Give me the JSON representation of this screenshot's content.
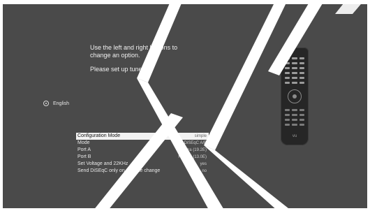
{
  "wizard": {
    "instruction_line1": "Use the left and right buttons to",
    "instruction_line2": "change an option.",
    "instruction_line3": "Please set up tuner A"
  },
  "language": {
    "label": "English",
    "icon": "radio-icon"
  },
  "config_menu": [
    {
      "label": "Configuration Mode",
      "value": "simple",
      "selected": true
    },
    {
      "label": "Mode",
      "value": "DiSEqC A/B",
      "selected": false
    },
    {
      "label": "Port A",
      "value": "Astra (19.2E)",
      "selected": false
    },
    {
      "label": "Port B",
      "value": "Hotbird (13.0E)",
      "selected": false
    },
    {
      "label": "Set Voltage and 22KHz",
      "value": "yes",
      "selected": false
    },
    {
      "label": "Send DiSEqC only on satellite change",
      "value": "no",
      "selected": false
    }
  ],
  "remote": {
    "icon": "remote-control-icon",
    "logo": "vu"
  },
  "colors": {
    "screen_bg": "#4a4a4a",
    "selected_row": "#f2f2f2",
    "watermark": "#ffffff"
  }
}
